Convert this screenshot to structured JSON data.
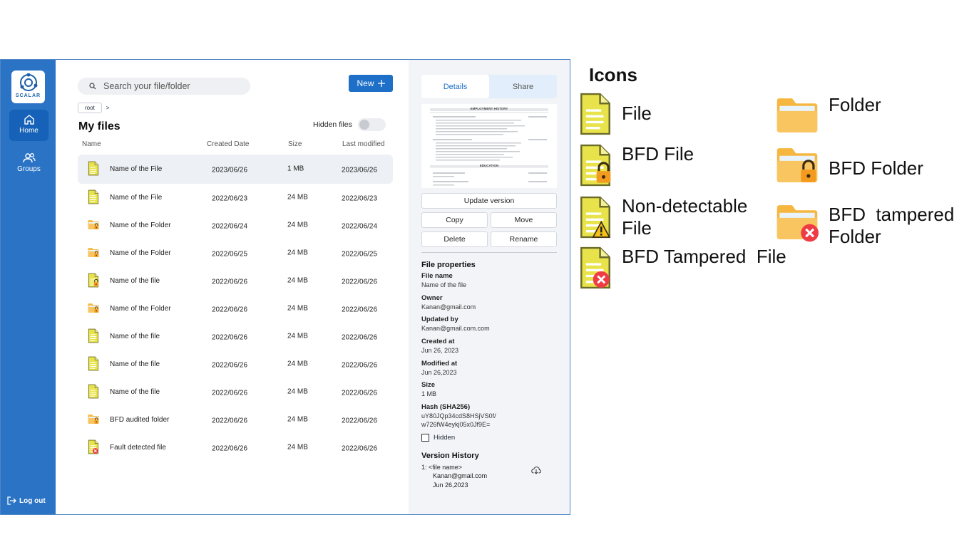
{
  "sidebar": {
    "logo_text": "SCALAR",
    "items": [
      {
        "label": "Home",
        "icon": "home-icon"
      },
      {
        "label": "Groups",
        "icon": "groups-icon"
      }
    ],
    "logout_label": "Log out"
  },
  "toolbar": {
    "search_placeholder": "Search your file/folder",
    "new_label": "New"
  },
  "breadcrumb": {
    "root": "root",
    "separator": ">"
  },
  "main": {
    "title": "My files",
    "hidden_files_label": "Hidden files",
    "columns": [
      "Name",
      "Created Date",
      "Size",
      "Last modified"
    ],
    "rows": [
      {
        "icon": "file-icon",
        "name": "Name of the File",
        "created": "2023/06/26",
        "size": "1 MB",
        "modified": "2023/06/26",
        "selected": true
      },
      {
        "icon": "file-icon",
        "name": "Name of the File",
        "created": "2022/06/23",
        "size": "24 MB",
        "modified": "2022/06/23"
      },
      {
        "icon": "bfd-folder-icon",
        "name": "Name of the Folder",
        "created": "2022/06/24",
        "size": "24 MB",
        "modified": "2022/06/24"
      },
      {
        "icon": "bfd-folder-icon",
        "name": "Name of the Folder",
        "created": "2022/06/25",
        "size": "24 MB",
        "modified": "2022/06/25"
      },
      {
        "icon": "bfd-file-icon",
        "name": "Name of the file",
        "created": "2022/06/26",
        "size": "24 MB",
        "modified": "2022/06/26"
      },
      {
        "icon": "bfd-folder-icon",
        "name": "Name of the Folder",
        "created": "2022/06/26",
        "size": "24 MB",
        "modified": "2022/06/26"
      },
      {
        "icon": "file-icon",
        "name": "Name of the file",
        "created": "2022/06/26",
        "size": "24 MB",
        "modified": "2022/06/26"
      },
      {
        "icon": "file-icon",
        "name": "Name of the file",
        "created": "2022/06/26",
        "size": "24 MB",
        "modified": "2022/06/26"
      },
      {
        "icon": "file-icon",
        "name": "Name of the file",
        "created": "2022/06/26",
        "size": "24 MB",
        "modified": "2022/06/26"
      },
      {
        "icon": "bfd-folder-icon",
        "name": "BFD audited folder",
        "created": "2022/06/26",
        "size": "24 MB",
        "modified": "2022/06/26"
      },
      {
        "icon": "bfd-tampered-file-icon",
        "name": "Fault detected file",
        "created": "2022/06/26",
        "size": "24 MB",
        "modified": "2022/06/26"
      }
    ]
  },
  "details": {
    "tabs": [
      "Details",
      "Share"
    ],
    "preview_headings": [
      "EMPLOYMENT HISTORY",
      "EDUCATION"
    ],
    "buttons": {
      "update": "Update version",
      "copy": "Copy",
      "move": "Move",
      "delete": "Delete",
      "rename": "Rename"
    },
    "properties_title": "File properties",
    "properties": [
      {
        "key": "File name",
        "value": "Name of the file"
      },
      {
        "key": "Owner",
        "value": "Kanan@gmail.com"
      },
      {
        "key": "Updated by",
        "value": "Kanan@gmail.com.com"
      },
      {
        "key": "Created at",
        "value": "Jun 26, 2023"
      },
      {
        "key": "Modified at",
        "value": "Jun 26,2023"
      },
      {
        "key": "Size",
        "value": "1 MB"
      },
      {
        "key": "Hash (SHA256)",
        "value": "uY80JQp34cdS8HSjVS0f/ w726fW4eykj05x0Jf9E="
      }
    ],
    "hidden_label": "Hidden",
    "version_history_title": "Version History",
    "version": {
      "line1": "1: <file name>",
      "email": "Kanan@gmail.com",
      "date": "Jun 26,2023"
    }
  },
  "legend": {
    "title": "Icons",
    "items": [
      {
        "icon": "file-icon",
        "label": "File"
      },
      {
        "icon": "bfd-file-icon",
        "label": "BFD File"
      },
      {
        "icon": "non-detectable-file-icon",
        "label": "Non-detectable File"
      },
      {
        "icon": "bfd-tampered-file-icon",
        "label": "BFD Tampered  File"
      },
      {
        "icon": "folder-icon",
        "label": "Folder"
      },
      {
        "icon": "bfd-folder-icon",
        "label": "BFD Folder"
      },
      {
        "icon": "bfd-tampered-folder-icon",
        "label": "BFD  tampered Folder"
      }
    ]
  },
  "colors": {
    "sidebar": "#2a73c5",
    "accent": "#1e6fc8",
    "file_yellow": "#e8e34a",
    "folder_orange": "#f9c560",
    "lock_orange": "#f39b1f",
    "error_red": "#ef3b44"
  }
}
